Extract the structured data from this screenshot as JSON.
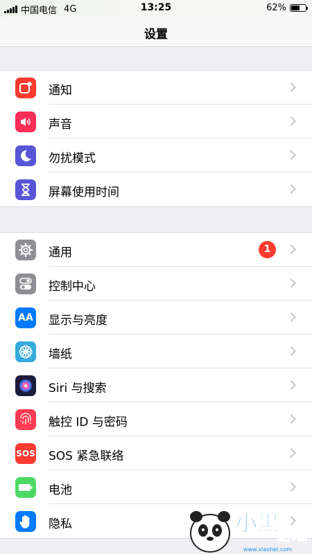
{
  "status_bar": {
    "carrier": "中国电信",
    "network": "4G",
    "time": "13:25",
    "battery_percent": "62%",
    "battery_level": 0.62
  },
  "nav": {
    "title": "设置"
  },
  "groups": [
    {
      "items": [
        {
          "label": "通知",
          "icon": "notifications-icon",
          "color": "#fe3b30"
        },
        {
          "label": "声音",
          "icon": "sounds-icon",
          "color": "#fd2d55"
        },
        {
          "label": "勿扰模式",
          "icon": "do-not-disturb-moon-icon",
          "color": "#5856d6"
        },
        {
          "label": "屏幕使用时间",
          "icon": "hourglass-icon",
          "color": "#5856d6"
        }
      ]
    },
    {
      "items": [
        {
          "label": "通用",
          "icon": "gear-icon",
          "color": "#8e8e93",
          "badge": "1"
        },
        {
          "label": "控制中心",
          "icon": "toggles-icon",
          "color": "#8e8e93"
        },
        {
          "label": "显示与亮度",
          "icon": "text-size-icon",
          "color": "#007aff",
          "icon_text": "AA"
        },
        {
          "label": "墙纸",
          "icon": "wallpaper-flower-icon",
          "color": "#35aadc"
        },
        {
          "label": "Siri 与搜索",
          "icon": "siri-icon",
          "color": "#1c1c3a"
        },
        {
          "label": "触控 ID 与密码",
          "icon": "fingerprint-icon",
          "color": "#fe3b52"
        },
        {
          "label": "SOS 紧急联络",
          "icon": "sos-icon",
          "color": "#fe3b30",
          "icon_text": "SOS"
        },
        {
          "label": "电池",
          "icon": "battery-icon",
          "color": "#4cd964"
        },
        {
          "label": "隐私",
          "icon": "privacy-hand-icon",
          "color": "#007aff"
        }
      ]
    }
  ],
  "watermark": {
    "text": "小黑游戏",
    "url": "www.xiaohei.com"
  }
}
